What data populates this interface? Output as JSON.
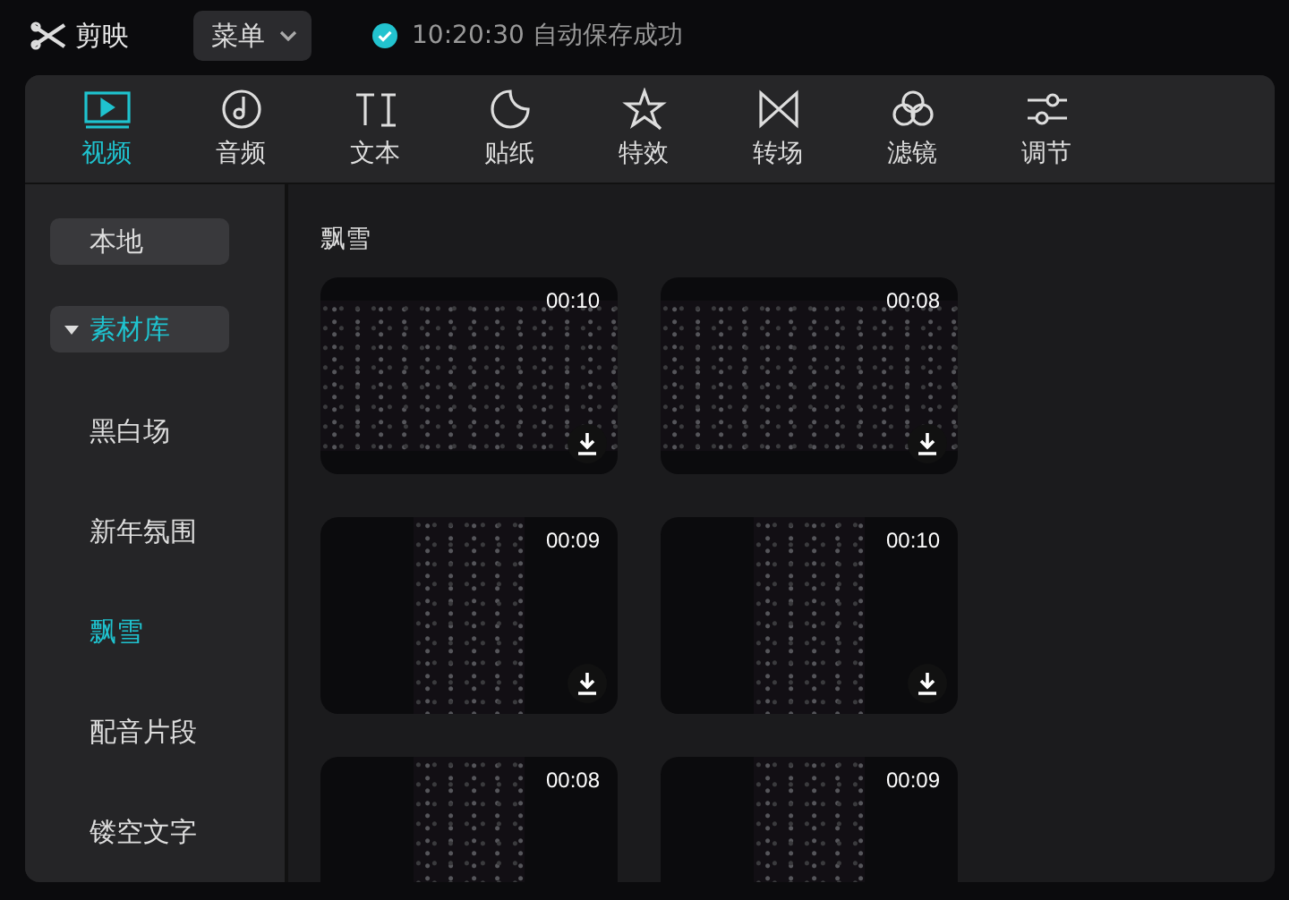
{
  "app": {
    "name": "剪映"
  },
  "menu": {
    "label": "菜单"
  },
  "save_status": {
    "text": "10:20:30 自动保存成功"
  },
  "tabs": [
    {
      "label": "视频",
      "kind": "video",
      "selected": true
    },
    {
      "label": "音频",
      "kind": "audio",
      "selected": false
    },
    {
      "label": "文本",
      "kind": "text",
      "selected": false
    },
    {
      "label": "贴纸",
      "kind": "sticker",
      "selected": false
    },
    {
      "label": "特效",
      "kind": "effects",
      "selected": false
    },
    {
      "label": "转场",
      "kind": "transition",
      "selected": false
    },
    {
      "label": "滤镜",
      "kind": "filter",
      "selected": false
    },
    {
      "label": "调节",
      "kind": "adjust",
      "selected": false
    }
  ],
  "sidebar": {
    "items": [
      {
        "label": "本地",
        "selected": false
      },
      {
        "label": "素材库",
        "expanded": true,
        "children": [
          {
            "label": "黑白场",
            "selected": false
          },
          {
            "label": "新年氛围",
            "selected": false
          },
          {
            "label": "飘雪",
            "selected": true
          },
          {
            "label": "配音片段",
            "selected": false
          },
          {
            "label": "镂空文字",
            "selected": false
          }
        ]
      }
    ]
  },
  "content": {
    "heading": "飘雪",
    "clips": [
      {
        "duration": "00:10",
        "kind": "landscape"
      },
      {
        "duration": "00:08",
        "kind": "landscape"
      },
      {
        "duration": "00:09",
        "kind": "portrait"
      },
      {
        "duration": "00:10",
        "kind": "portrait"
      },
      {
        "duration": "00:08",
        "kind": "portrait"
      },
      {
        "duration": "00:09",
        "kind": "portrait"
      }
    ]
  }
}
